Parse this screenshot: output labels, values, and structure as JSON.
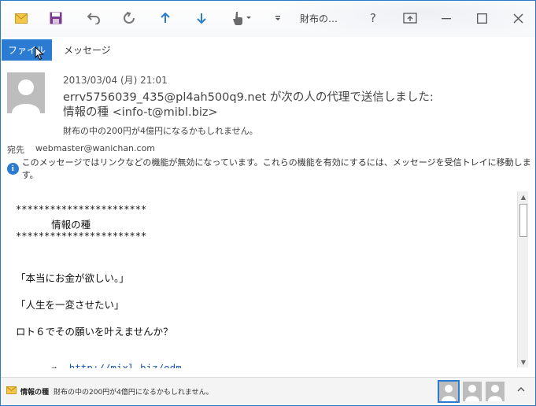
{
  "titlebar": {
    "title": "財布の…",
    "help_glyph": "?"
  },
  "tabs": {
    "file_label": "ファイル",
    "message_label": "メッセージ"
  },
  "header": {
    "date": "2013/03/04 (月) 21:01",
    "sender_line1": "errv5756039_435@pl4ah500q9.net が次の人の代理で送信しました:",
    "sender_line2": "情報の種 <info-t@mibl.biz>",
    "subject": "財布の中の200円が4億円になるかもしれません。",
    "to_label": "宛先",
    "to_value": "webmaster@wanichan.com",
    "info_message": "このメッセージではリンクなどの機能が無効になっています。これらの機能を有効にするには、メッセージを受信トレイに移動します。"
  },
  "body": {
    "stars1": "***********************",
    "banner": "      情報の種",
    "stars2": "***********************",
    "line1": "「本当にお金が欲しい。」",
    "line2": "「人生を一変させたい」",
    "line3": "ロト６でその願いを叶えませんか？",
    "arrow": "⇒",
    "link": "http://mixl.biz/odm"
  },
  "footer": {
    "from": "情報の種",
    "subject": "財布の中の200円が4億円になるかもしれません。"
  },
  "colors": {
    "accent": "#2b7bd3",
    "link": "#1a52b4",
    "avatar": "#bdbdbd"
  }
}
